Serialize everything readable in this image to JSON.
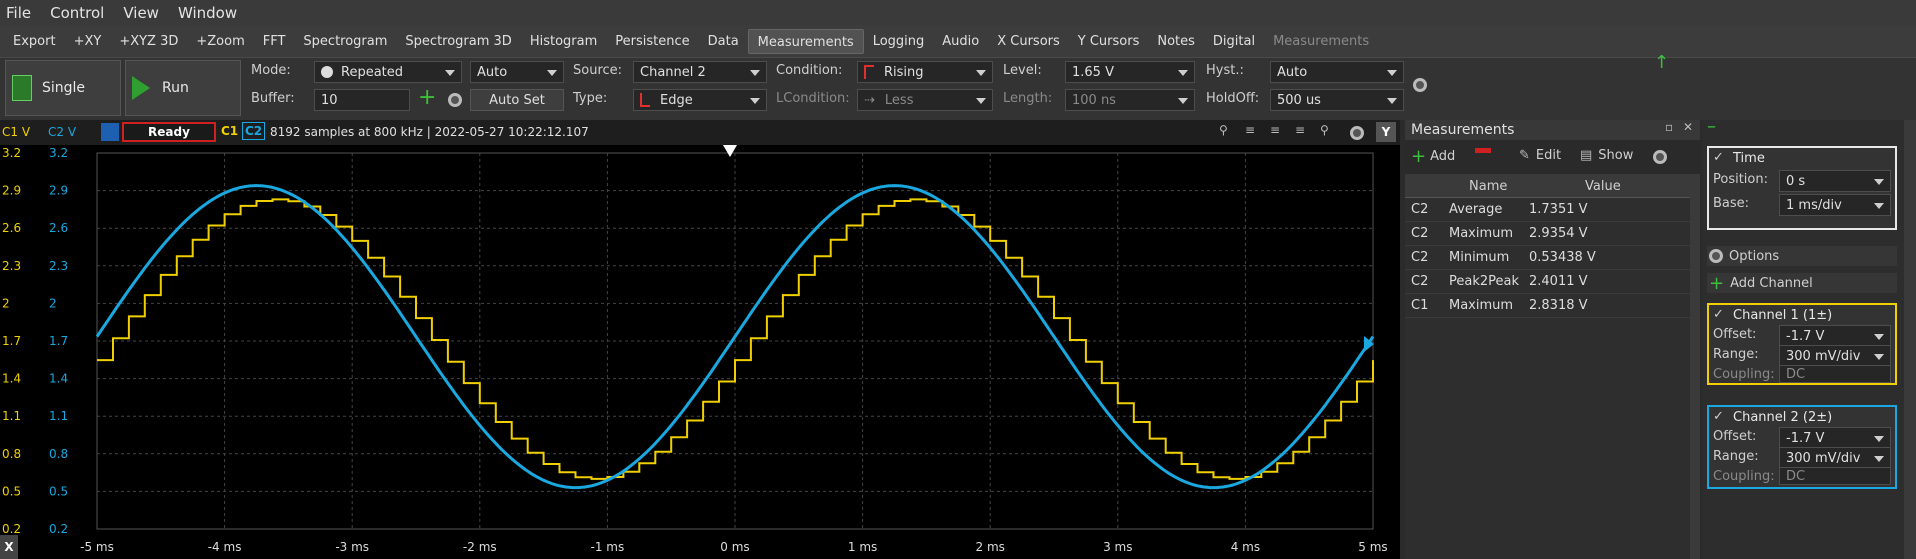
{
  "menu": [
    "File",
    "Control",
    "View",
    "Window"
  ],
  "tabs": [
    "Export",
    "+XY",
    "+XYZ 3D",
    "+Zoom",
    "FFT",
    "Spectrogram",
    "Spectrogram 3D",
    "Histogram",
    "Persistence",
    "Data",
    "Measurements",
    "Logging",
    "Audio",
    "X Cursors",
    "Y Cursors",
    "Notes",
    "Digital",
    "Measurements"
  ],
  "toolbar": {
    "single": "Single",
    "run": "Run",
    "mode_label": "Mode:",
    "mode": "Repeated",
    "auto": "Auto",
    "buffer_label": "Buffer:",
    "buffer": "10",
    "autoset": "Auto Set",
    "source_label": "Source:",
    "source": "Channel 2",
    "type_label": "Type:",
    "type": "Edge",
    "condition_label": "Condition:",
    "condition": "Rising",
    "lcondition_label": "LCondition:",
    "lcondition": "Less",
    "level_label": "Level:",
    "level": "1.65 V",
    "length_label": "Length:",
    "length": "100 ns",
    "hyst_label": "Hyst.:",
    "hyst": "Auto",
    "holdoff_label": "HoldOff:",
    "holdoff": "500 us"
  },
  "status": {
    "c1v": "C1 V",
    "c2v": "C2 V",
    "state": "Ready",
    "c1": "C1",
    "c2": "C2",
    "info": "8192 samples at 800 kHz | 2022-05-27 10:22:12.107",
    "y": "Y"
  },
  "yticks": [
    "3.2",
    "2.9",
    "2.6",
    "2.3",
    "2",
    "1.7",
    "1.4",
    "1.1",
    "0.8",
    "0.5",
    "0.2"
  ],
  "xticks": [
    "-5 ms",
    "-4 ms",
    "-3 ms",
    "-2 ms",
    "-1 ms",
    "0 ms",
    "1 ms",
    "2 ms",
    "3 ms",
    "4 ms",
    "5 ms"
  ],
  "measurements": {
    "title": "Measurements",
    "add": "Add",
    "edit": "Edit",
    "show": "Show",
    "col_name": "Name",
    "col_value": "Value",
    "rows": [
      [
        "C2",
        "Average",
        "1.7351 V"
      ],
      [
        "C2",
        "Maximum",
        "2.9354 V"
      ],
      [
        "C2",
        "Minimum",
        "0.53438 V"
      ],
      [
        "C2",
        "Peak2Peak",
        "2.4011 V"
      ],
      [
        "C1",
        "Maximum",
        "2.8318 V"
      ]
    ]
  },
  "time": {
    "title": "Time",
    "position_label": "Position:",
    "position": "0 s",
    "base_label": "Base:",
    "base": "1 ms/div"
  },
  "options": "Options",
  "add_channel": "Add Channel",
  "ch1": {
    "title": "Channel 1 (1±)",
    "offset_label": "Offset:",
    "offset": "-1.7 V",
    "range_label": "Range:",
    "range": "300 mV/div",
    "coupling_label": "Coupling:",
    "coupling": "DC"
  },
  "ch2": {
    "title": "Channel 2 (2±)",
    "offset_label": "Offset:",
    "offset": "-1.7 V",
    "range_label": "Range:",
    "range": "300 mV/div",
    "coupling_label": "Coupling:",
    "coupling": "DC"
  },
  "colors": {
    "ch1": "#f0d000",
    "ch2": "#1aa8e0",
    "ready_border": "#d02020"
  },
  "chart_data": {
    "type": "line",
    "xlim": [
      -5,
      5
    ],
    "ylim": [
      0.2,
      3.2
    ],
    "xunit": "ms",
    "yunit": "V",
    "series": [
      {
        "name": "C1",
        "type": "staircase",
        "min": 0.6,
        "max": 2.83,
        "period_ms": 5
      },
      {
        "name": "C2",
        "type": "sine",
        "min": 0.53,
        "max": 2.94,
        "period_ms": 5
      }
    ]
  }
}
